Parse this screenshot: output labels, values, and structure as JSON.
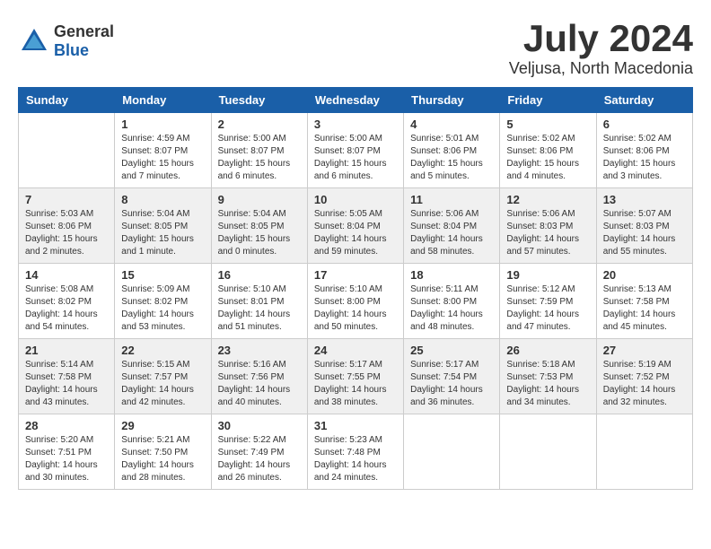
{
  "header": {
    "logo_general": "General",
    "logo_blue": "Blue",
    "month_title": "July 2024",
    "location": "Veljusa, North Macedonia"
  },
  "weekdays": [
    "Sunday",
    "Monday",
    "Tuesday",
    "Wednesday",
    "Thursday",
    "Friday",
    "Saturday"
  ],
  "weeks": [
    [
      {
        "day": "",
        "info": ""
      },
      {
        "day": "1",
        "info": "Sunrise: 4:59 AM\nSunset: 8:07 PM\nDaylight: 15 hours\nand 7 minutes."
      },
      {
        "day": "2",
        "info": "Sunrise: 5:00 AM\nSunset: 8:07 PM\nDaylight: 15 hours\nand 6 minutes."
      },
      {
        "day": "3",
        "info": "Sunrise: 5:00 AM\nSunset: 8:07 PM\nDaylight: 15 hours\nand 6 minutes."
      },
      {
        "day": "4",
        "info": "Sunrise: 5:01 AM\nSunset: 8:06 PM\nDaylight: 15 hours\nand 5 minutes."
      },
      {
        "day": "5",
        "info": "Sunrise: 5:02 AM\nSunset: 8:06 PM\nDaylight: 15 hours\nand 4 minutes."
      },
      {
        "day": "6",
        "info": "Sunrise: 5:02 AM\nSunset: 8:06 PM\nDaylight: 15 hours\nand 3 minutes."
      }
    ],
    [
      {
        "day": "7",
        "info": "Sunrise: 5:03 AM\nSunset: 8:06 PM\nDaylight: 15 hours\nand 2 minutes."
      },
      {
        "day": "8",
        "info": "Sunrise: 5:04 AM\nSunset: 8:05 PM\nDaylight: 15 hours\nand 1 minute."
      },
      {
        "day": "9",
        "info": "Sunrise: 5:04 AM\nSunset: 8:05 PM\nDaylight: 15 hours\nand 0 minutes."
      },
      {
        "day": "10",
        "info": "Sunrise: 5:05 AM\nSunset: 8:04 PM\nDaylight: 14 hours\nand 59 minutes."
      },
      {
        "day": "11",
        "info": "Sunrise: 5:06 AM\nSunset: 8:04 PM\nDaylight: 14 hours\nand 58 minutes."
      },
      {
        "day": "12",
        "info": "Sunrise: 5:06 AM\nSunset: 8:03 PM\nDaylight: 14 hours\nand 57 minutes."
      },
      {
        "day": "13",
        "info": "Sunrise: 5:07 AM\nSunset: 8:03 PM\nDaylight: 14 hours\nand 55 minutes."
      }
    ],
    [
      {
        "day": "14",
        "info": "Sunrise: 5:08 AM\nSunset: 8:02 PM\nDaylight: 14 hours\nand 54 minutes."
      },
      {
        "day": "15",
        "info": "Sunrise: 5:09 AM\nSunset: 8:02 PM\nDaylight: 14 hours\nand 53 minutes."
      },
      {
        "day": "16",
        "info": "Sunrise: 5:10 AM\nSunset: 8:01 PM\nDaylight: 14 hours\nand 51 minutes."
      },
      {
        "day": "17",
        "info": "Sunrise: 5:10 AM\nSunset: 8:00 PM\nDaylight: 14 hours\nand 50 minutes."
      },
      {
        "day": "18",
        "info": "Sunrise: 5:11 AM\nSunset: 8:00 PM\nDaylight: 14 hours\nand 48 minutes."
      },
      {
        "day": "19",
        "info": "Sunrise: 5:12 AM\nSunset: 7:59 PM\nDaylight: 14 hours\nand 47 minutes."
      },
      {
        "day": "20",
        "info": "Sunrise: 5:13 AM\nSunset: 7:58 PM\nDaylight: 14 hours\nand 45 minutes."
      }
    ],
    [
      {
        "day": "21",
        "info": "Sunrise: 5:14 AM\nSunset: 7:58 PM\nDaylight: 14 hours\nand 43 minutes."
      },
      {
        "day": "22",
        "info": "Sunrise: 5:15 AM\nSunset: 7:57 PM\nDaylight: 14 hours\nand 42 minutes."
      },
      {
        "day": "23",
        "info": "Sunrise: 5:16 AM\nSunset: 7:56 PM\nDaylight: 14 hours\nand 40 minutes."
      },
      {
        "day": "24",
        "info": "Sunrise: 5:17 AM\nSunset: 7:55 PM\nDaylight: 14 hours\nand 38 minutes."
      },
      {
        "day": "25",
        "info": "Sunrise: 5:17 AM\nSunset: 7:54 PM\nDaylight: 14 hours\nand 36 minutes."
      },
      {
        "day": "26",
        "info": "Sunrise: 5:18 AM\nSunset: 7:53 PM\nDaylight: 14 hours\nand 34 minutes."
      },
      {
        "day": "27",
        "info": "Sunrise: 5:19 AM\nSunset: 7:52 PM\nDaylight: 14 hours\nand 32 minutes."
      }
    ],
    [
      {
        "day": "28",
        "info": "Sunrise: 5:20 AM\nSunset: 7:51 PM\nDaylight: 14 hours\nand 30 minutes."
      },
      {
        "day": "29",
        "info": "Sunrise: 5:21 AM\nSunset: 7:50 PM\nDaylight: 14 hours\nand 28 minutes."
      },
      {
        "day": "30",
        "info": "Sunrise: 5:22 AM\nSunset: 7:49 PM\nDaylight: 14 hours\nand 26 minutes."
      },
      {
        "day": "31",
        "info": "Sunrise: 5:23 AM\nSunset: 7:48 PM\nDaylight: 14 hours\nand 24 minutes."
      },
      {
        "day": "",
        "info": ""
      },
      {
        "day": "",
        "info": ""
      },
      {
        "day": "",
        "info": ""
      }
    ]
  ]
}
